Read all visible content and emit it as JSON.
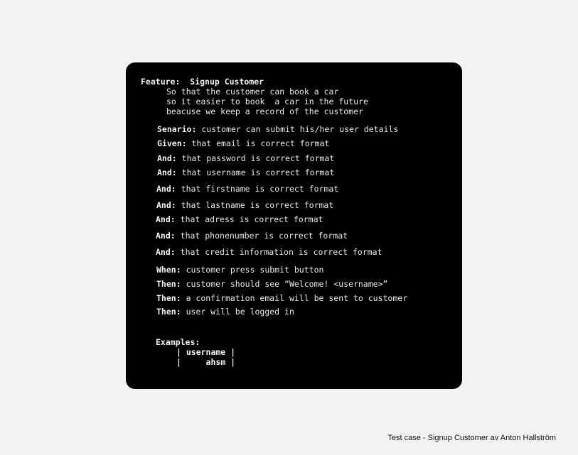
{
  "feature": {
    "keyword": "Feature:",
    "title": "Signup Customer",
    "description": [
      "So that the customer can book a car",
      "so it easier to book  a car in the future",
      "beacuse we keep a record of the customer"
    ]
  },
  "scenario": {
    "keyword": "Senario:",
    "text": "customer can submit his/her user details"
  },
  "steps": [
    {
      "keyword": "Given:",
      "text": "that email is correct format"
    },
    {
      "keyword": "And:",
      "text": "that password is correct format"
    },
    {
      "keyword": "And:",
      "text": "that username is correct format"
    },
    {
      "keyword": "And:",
      "text": "that firstname is correct format"
    },
    {
      "keyword": "And:",
      "text": "that lastname is correct format"
    },
    {
      "keyword": "And:",
      "text": "that adress is correct format"
    },
    {
      "keyword": "And:",
      "text": "that phonenumber is correct format"
    },
    {
      "keyword": "And:",
      "text": "that credit information is correct format"
    },
    {
      "keyword": "When:",
      "text": "customer press submit button"
    },
    {
      "keyword": "Then:",
      "text": "customer should see “Welcome! <username>”"
    },
    {
      "keyword": "Then:",
      "text": "a confirmation email will be sent to customer"
    },
    {
      "keyword": "Then:",
      "text": "user will be logged in"
    }
  ],
  "examples": {
    "keyword": "Examples:",
    "rows": [
      "| username |",
      "|     ahsm |"
    ]
  },
  "footer": "Test case - Signup Customer av Anton Hallström"
}
